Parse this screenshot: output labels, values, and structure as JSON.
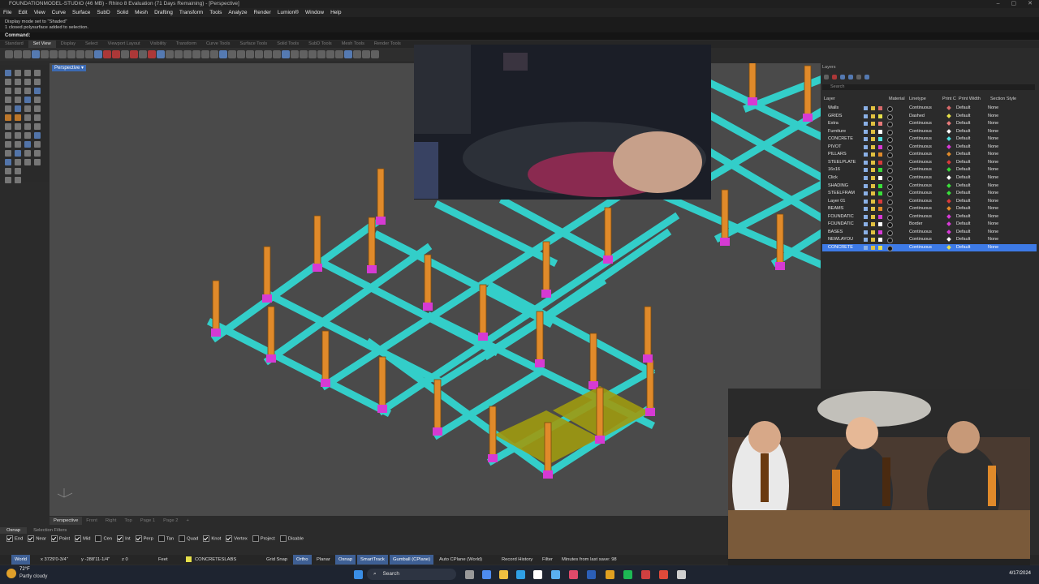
{
  "titlebar": {
    "title": "FOUNDATIONMODEL-STUDIO (46 MB) - Rhino 8 Evaluation (71 Days Remaining) - [Perspective]"
  },
  "menu": [
    "File",
    "Edit",
    "View",
    "Curve",
    "Surface",
    "SubD",
    "Solid",
    "Mesh",
    "Drafting",
    "Transform",
    "Tools",
    "Analyze",
    "Render",
    "Lumion®",
    "Window",
    "Help"
  ],
  "command_history": [
    "Display mode set to \"Shaded\"",
    "1 closed polysurface added to selection."
  ],
  "command_prompt": "Command:",
  "toolbar_tabs": [
    "Standard",
    "Set View",
    "Display",
    "Select",
    "Viewport Layout",
    "Visibility",
    "Transform",
    "Curve Tools",
    "Surface Tools",
    "Solid Tools",
    "SubD Tools",
    "Mesh Tools",
    "Render Tools"
  ],
  "active_toolbar_tab": "Set View",
  "viewport": {
    "label": "Perspective"
  },
  "layers_panel": {
    "title": "Layers",
    "search_placeholder": "Search",
    "columns": [
      "Layer",
      "Material",
      "Linetype",
      "Print C",
      "Print Width",
      "Section Style"
    ],
    "rows": [
      {
        "name": "Walls",
        "color": "#d86a6a",
        "linetype": "Continuous",
        "print_color": "#d86a6a",
        "width": "Default",
        "section": "None"
      },
      {
        "name": "GRIDS",
        "color": "#e6e04a",
        "linetype": "Dashed",
        "print_color": "#e6e04a",
        "width": "Default",
        "section": "None"
      },
      {
        "name": "Extra",
        "color": "#e87a7a",
        "linetype": "Continuous",
        "print_color": "#e87a7a",
        "width": "Default",
        "section": "None"
      },
      {
        "name": "Furniture",
        "color": "#ffffff",
        "linetype": "Continuous",
        "print_color": "#ffffff",
        "width": "Default",
        "section": "None"
      },
      {
        "name": "CONCRETE",
        "color": "#4fe0e0",
        "linetype": "Continuous",
        "print_color": "#4fe0e0",
        "width": "Default",
        "section": "None"
      },
      {
        "name": "PIVOT",
        "color": "#d83ad8",
        "linetype": "Continuous",
        "print_color": "#d83ad8",
        "width": "Default",
        "section": "None"
      },
      {
        "name": "PILLARS",
        "color": "#e08a2a",
        "linetype": "Continuous",
        "print_color": "#e08a2a",
        "width": "Default",
        "section": "None"
      },
      {
        "name": "STEELPLATE",
        "color": "#d83a3a",
        "linetype": "Continuous",
        "print_color": "#d83a3a",
        "width": "Default",
        "section": "None"
      },
      {
        "name": "16x16",
        "color": "#3ad83a",
        "linetype": "Continuous",
        "print_color": "#3ad83a",
        "width": "Default",
        "section": "None"
      },
      {
        "name": "Click",
        "color": "#ffffff",
        "linetype": "Continuous",
        "print_color": "#ffffff",
        "width": "Default",
        "section": "None"
      },
      {
        "name": "SHADING",
        "color": "#3ae03a",
        "linetype": "Continuous",
        "print_color": "#3ae03a",
        "width": "Default",
        "section": "None"
      },
      {
        "name": "STEELFRAM",
        "color": "#3ae03a",
        "linetype": "Continuous",
        "print_color": "#3ae03a",
        "width": "Default",
        "section": "None"
      },
      {
        "name": "Layer 01",
        "color": "#d83a3a",
        "linetype": "Continuous",
        "print_color": "#d83a3a",
        "width": "Default",
        "section": "None"
      },
      {
        "name": "BEAMS",
        "color": "#e08a2a",
        "linetype": "Continuous",
        "print_color": "#e08a2a",
        "width": "Default",
        "section": "None"
      },
      {
        "name": "FOUNDATIC",
        "color": "#d83ad8",
        "linetype": "Continuous",
        "print_color": "#d83ad8",
        "width": "Default",
        "section": "None"
      },
      {
        "name": "FOUNDATIC",
        "color": "#ffffff",
        "linetype": "Border",
        "print_color": "#d83ad8",
        "width": "Default",
        "section": "None"
      },
      {
        "name": "BASES",
        "color": "#d83ad8",
        "linetype": "Continuous",
        "print_color": "#d83ad8",
        "width": "Default",
        "section": "None"
      },
      {
        "name": "NEWLAYOU",
        "color": "#ffffff",
        "linetype": "Continuous",
        "print_color": "#ffffff",
        "width": "Default",
        "section": "None"
      },
      {
        "name": "CONCRETE",
        "color": "#e6e04a",
        "linetype": "Continuous",
        "print_color": "#e6e04a",
        "width": "Default",
        "section": "None",
        "selected": true
      }
    ]
  },
  "view_tabs": [
    "Perspective",
    "Front",
    "Right",
    "Top",
    "Page 1",
    "Page 2"
  ],
  "osnap_tabs": [
    "Osnap",
    "Selection Filters"
  ],
  "osnap": [
    {
      "label": "End",
      "on": true
    },
    {
      "label": "Near",
      "on": true
    },
    {
      "label": "Point",
      "on": true
    },
    {
      "label": "Mid",
      "on": true
    },
    {
      "label": "Cen",
      "on": false
    },
    {
      "label": "Int",
      "on": true
    },
    {
      "label": "Perp",
      "on": true
    },
    {
      "label": "Tan",
      "on": false
    },
    {
      "label": "Quad",
      "on": false
    },
    {
      "label": "Knot",
      "on": true
    },
    {
      "label": "Vertex",
      "on": true
    },
    {
      "label": "Project",
      "on": false
    },
    {
      "label": "Disable",
      "on": false
    }
  ],
  "statusbar": {
    "cplane": "World",
    "x": "x 3729'0-3/4\"",
    "y": "y -288'11-1/4\"",
    "z": "z 0",
    "units": "Feet",
    "layer": "CONCRETESLABS",
    "grid_snap": "Grid Snap",
    "ortho": "Ortho",
    "planar": "Planar",
    "osnap": "Osnap",
    "smarttrack": "SmartTrack",
    "gumball": "Gumball (CPlane)",
    "auto_cplane": "Auto CPlane (World)",
    "record_history": "Record History",
    "filter": "Filter",
    "minutes": "Minutes from last save: 98"
  },
  "taskbar": {
    "temp": "72°F",
    "weather": "Partly cloudy",
    "search": "Search",
    "date": "4/17/2024"
  }
}
